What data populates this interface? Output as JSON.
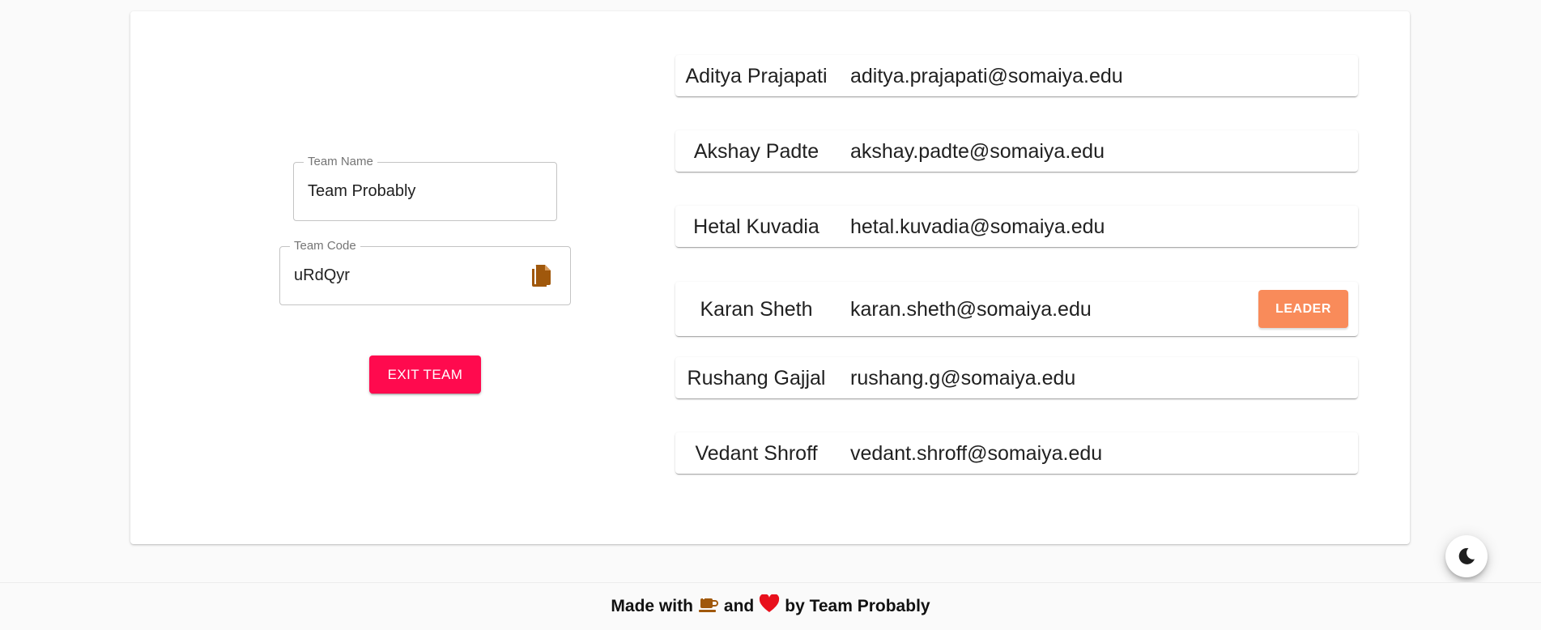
{
  "team": {
    "name_label": "Team Name",
    "name_value": "Team Probably",
    "code_label": "Team Code",
    "code_value": "uRdQyr",
    "copy_icon": "copy-icon",
    "exit_label": "EXIT TEAM"
  },
  "members": [
    {
      "name": "Aditya Prajapati",
      "email": "aditya.prajapati@somaiya.edu"
    },
    {
      "name": "Akshay Padte",
      "email": "akshay.padte@somaiya.edu"
    },
    {
      "name": "Hetal Kuvadia",
      "email": "hetal.kuvadia@somaiya.edu"
    },
    {
      "name": "Karan Sheth",
      "email": "karan.sheth@somaiya.edu",
      "badge": "LEADER"
    },
    {
      "name": "Rushang Gajjal",
      "email": "rushang.g@somaiya.edu"
    },
    {
      "name": "Vedant Shroff",
      "email": "vedant.shroff@somaiya.edu"
    }
  ],
  "footer": {
    "made_with": "Made with",
    "and": "and",
    "by": "by Team Probably",
    "coffee_icon": "coffee-icon",
    "heart_icon": "heart-icon"
  },
  "theme_toggle_icon": "moon-icon",
  "colors": {
    "exit_button": "#ff0a4e",
    "leader_badge": "#f98b5a",
    "copy_icon": "#a0580c",
    "heart": "#e8101c",
    "coffee": "#a0580c"
  }
}
